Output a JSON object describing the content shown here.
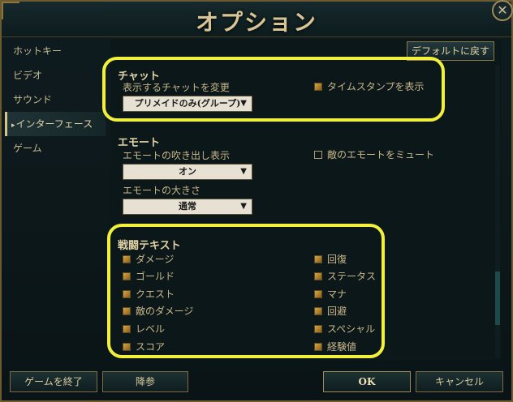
{
  "window": {
    "title": "オプション",
    "close_glyph": "✕"
  },
  "sidebar": {
    "items": [
      {
        "label": "ホットキー"
      },
      {
        "label": "ビデオ"
      },
      {
        "label": "サウンド"
      },
      {
        "label": "インターフェース",
        "active": true
      },
      {
        "label": "ゲーム"
      }
    ]
  },
  "header": {
    "default_button": "デフォルトに戻す"
  },
  "chat": {
    "title": "チャット",
    "change_label": "表示するチャットを変更",
    "select_value": "プリメイドのみ(グループ)",
    "timestamp_label": "タイムスタンプを表示",
    "timestamp_checked": true
  },
  "emote": {
    "title": "エモート",
    "bubble_label": "エモートの吹き出し表示",
    "bubble_value": "オン",
    "mute_label": "敵のエモートをミュート",
    "mute_checked": false,
    "size_label": "エモートの大きさ",
    "size_value": "通常"
  },
  "combat_text": {
    "title": "戦闘テキスト",
    "left": [
      "ダメージ",
      "ゴールド",
      "クエスト",
      "敵のダメージ",
      "レベル",
      "スコア"
    ],
    "right": [
      "回復",
      "ステータス",
      "マナ",
      "回避",
      "スペシャル",
      "経験値"
    ]
  },
  "footer": {
    "quit_button": "ゲームを終了",
    "surrender_button": "降参",
    "ok_button": "OK",
    "cancel_button": "キャンセル"
  },
  "colors": {
    "highlight": "#f2f03a",
    "accent": "#c8b88a",
    "checkbox": "#c9973a"
  },
  "icons": {
    "caret": "dropdown-caret-icon",
    "active_arrow": "triangle-right-icon"
  }
}
